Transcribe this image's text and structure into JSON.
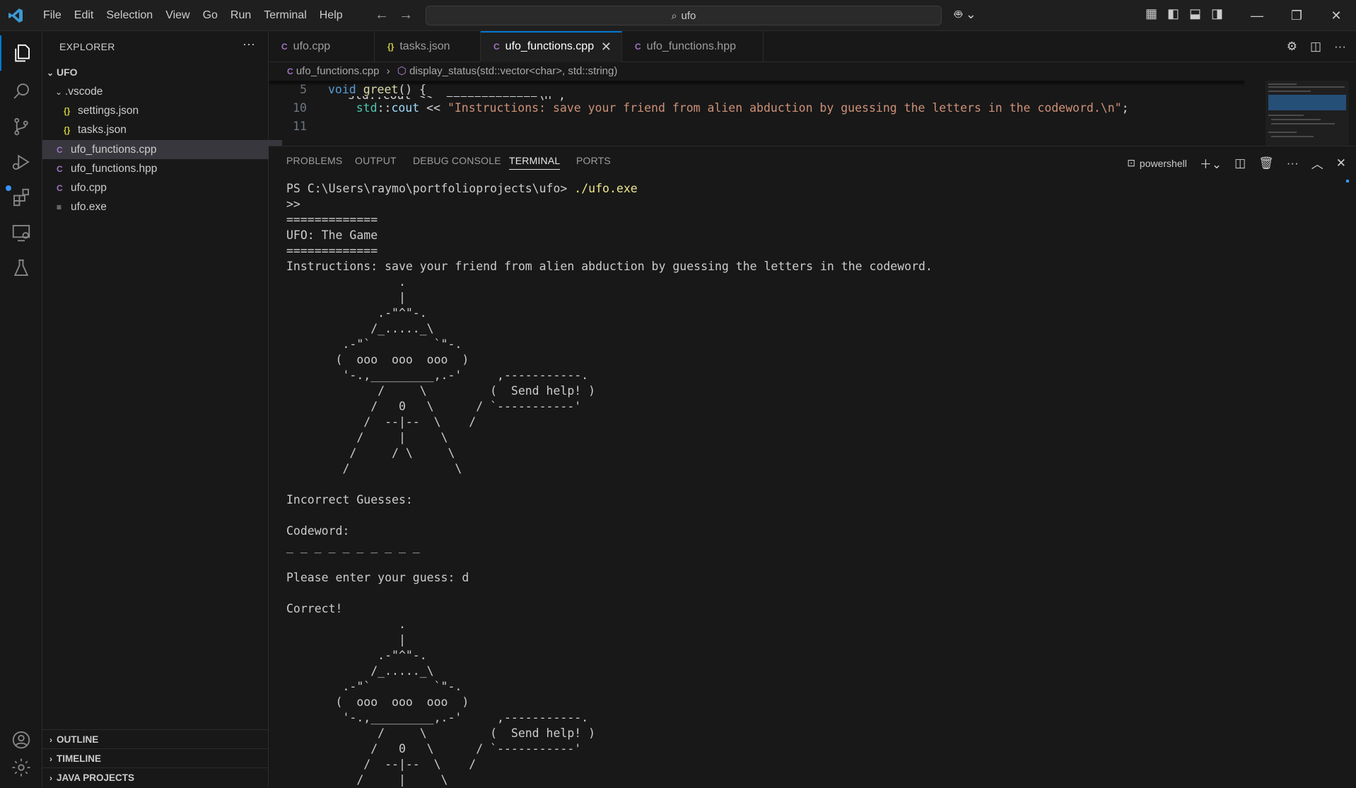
{
  "titlebar": {
    "menu": [
      "File",
      "Edit",
      "Selection",
      "View",
      "Go",
      "Run",
      "Terminal",
      "Help"
    ],
    "search_text": "ufo"
  },
  "sidebar": {
    "title": "EXPLORER",
    "root": "UFO",
    "items": [
      {
        "label": ".vscode",
        "kind": "folder"
      },
      {
        "label": "settings.json",
        "kind": "json"
      },
      {
        "label": "tasks.json",
        "kind": "json"
      },
      {
        "label": "ufo_functions.cpp",
        "kind": "cpp"
      },
      {
        "label": "ufo_functions.hpp",
        "kind": "cpp"
      },
      {
        "label": "ufo.cpp",
        "kind": "cpp"
      },
      {
        "label": "ufo.exe",
        "kind": "exe"
      }
    ],
    "sections": [
      "OUTLINE",
      "TIMELINE",
      "JAVA PROJECTS"
    ]
  },
  "tabs": [
    {
      "label": "ufo.cpp",
      "icon": "C++"
    },
    {
      "label": "tasks.json",
      "icon": "{}"
    },
    {
      "label": "ufo_functions.cpp",
      "icon": "C++"
    },
    {
      "label": "ufo_functions.hpp",
      "icon": "C++"
    }
  ],
  "active_tab": "ufo_functions.cpp",
  "breadcrumb": {
    "file": "ufo_functions.cpp",
    "symbol": "display_status(std::vector<char>, std::string)"
  },
  "editor": {
    "line5_num": "5",
    "line5_kw": "void",
    "line5_fn": "greet",
    "line5_rest": "() {",
    "line9_text": "std::cout << \"=============\\n\";",
    "line10_num": "10",
    "line10_ns": "std",
    "line10_sep": "::",
    "line10_id": "cout",
    "line10_op": " << ",
    "line10_str": "\"Instructions: save your friend from alien abduction by guessing the letters in the codeword.\\n\"",
    "line10_end": ";",
    "line11_num": "11"
  },
  "panel": {
    "tabs": [
      "PROBLEMS",
      "OUTPUT",
      "DEBUG CONSOLE",
      "TERMINAL",
      "PORTS"
    ],
    "active": "TERMINAL",
    "shell": "powershell"
  },
  "terminal": {
    "prompt": "PS C:\\Users\\raymo\\portfolioprojects\\ufo> ",
    "command": "./ufo.exe",
    "lines": [
      ">>",
      "=============",
      "UFO: The Game",
      "=============",
      "Instructions: save your friend from alien abduction by guessing the letters in the codeword.",
      "                .",
      "                |",
      "             .-\"^\"-.",
      "            /_....._\\",
      "        .-\"`         `\"-.",
      "       (  ooo  ooo  ooo  )",
      "        '-.,_________,.-'     ,-----------.",
      "             /     \\         (  Send help! )",
      "            /   0   \\      / `-----------'",
      "           /  --|--  \\    /",
      "          /     |     \\",
      "         /     / \\     \\",
      "        /               \\",
      "",
      "Incorrect Guesses:",
      "",
      "Codeword:",
      "_ _ _ _ _ _ _ _ _ _",
      "",
      "Please enter your guess: d",
      "",
      "Correct!",
      "                .",
      "                |",
      "             .-\"^\"-.",
      "            /_....._\\",
      "        .-\"`         `\"-.",
      "       (  ooo  ooo  ooo  )",
      "        '-.,_________,.-'     ,-----------.",
      "             /     \\         (  Send help! )",
      "            /   0   \\      / `-----------'",
      "           /  --|--  \\    /",
      "          /     |     \\"
    ]
  }
}
